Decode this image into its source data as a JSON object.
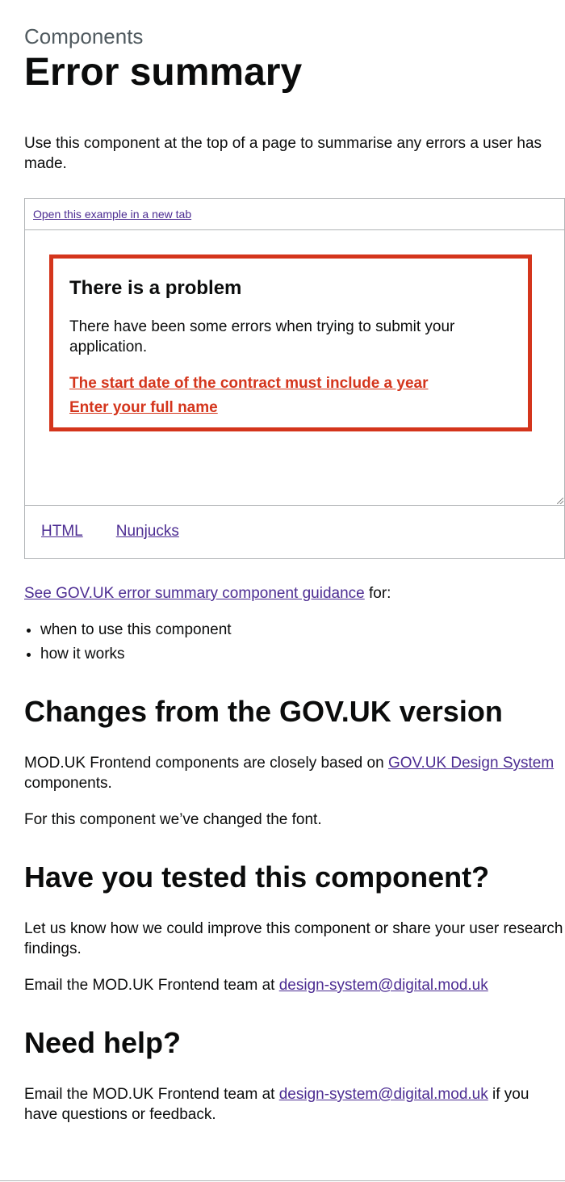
{
  "header": {
    "caption": "Components",
    "title": "Error summary"
  },
  "lead": "Use this component at the top of a page to summarise any errors a user has made.",
  "example": {
    "open_link": "Open this example in a new tab",
    "error_summary": {
      "title": "There is a problem",
      "body": "There have been some errors when trying to submit your application.",
      "errors": [
        "The start date of the contract must include a year",
        "Enter your full name"
      ]
    },
    "tabs": [
      "HTML",
      "Nunjucks"
    ]
  },
  "guidance": {
    "link": "See GOV.UK error summary component guidance",
    "suffix": " for:",
    "bullets": [
      "when to use this component",
      "how it works"
    ]
  },
  "changes": {
    "heading": "Changes from the GOV.UK version",
    "p1_before": "MOD.UK Frontend components are closely based on ",
    "p1_link": "GOV.UK Design System",
    "p1_after": " components.",
    "p2": "For this component we’ve changed the font."
  },
  "tested": {
    "heading": "Have you tested this component?",
    "p1": "Let us know how we could improve this component or share your user research findings.",
    "p2_before": "Email the MOD.UK Frontend team at ",
    "p2_link": "design-system@digital.mod.uk"
  },
  "help": {
    "heading": "Need help?",
    "p_before": "Email the MOD.UK Frontend team at ",
    "p_link": "design-system@digital.mod.uk",
    "p_after": " if you have questions or feedback."
  },
  "colors": {
    "error": "#d4351c",
    "link": "#4c2c92",
    "text": "#0b0c0c",
    "secondary_text": "#505a5f",
    "border": "#b1b4b6"
  }
}
